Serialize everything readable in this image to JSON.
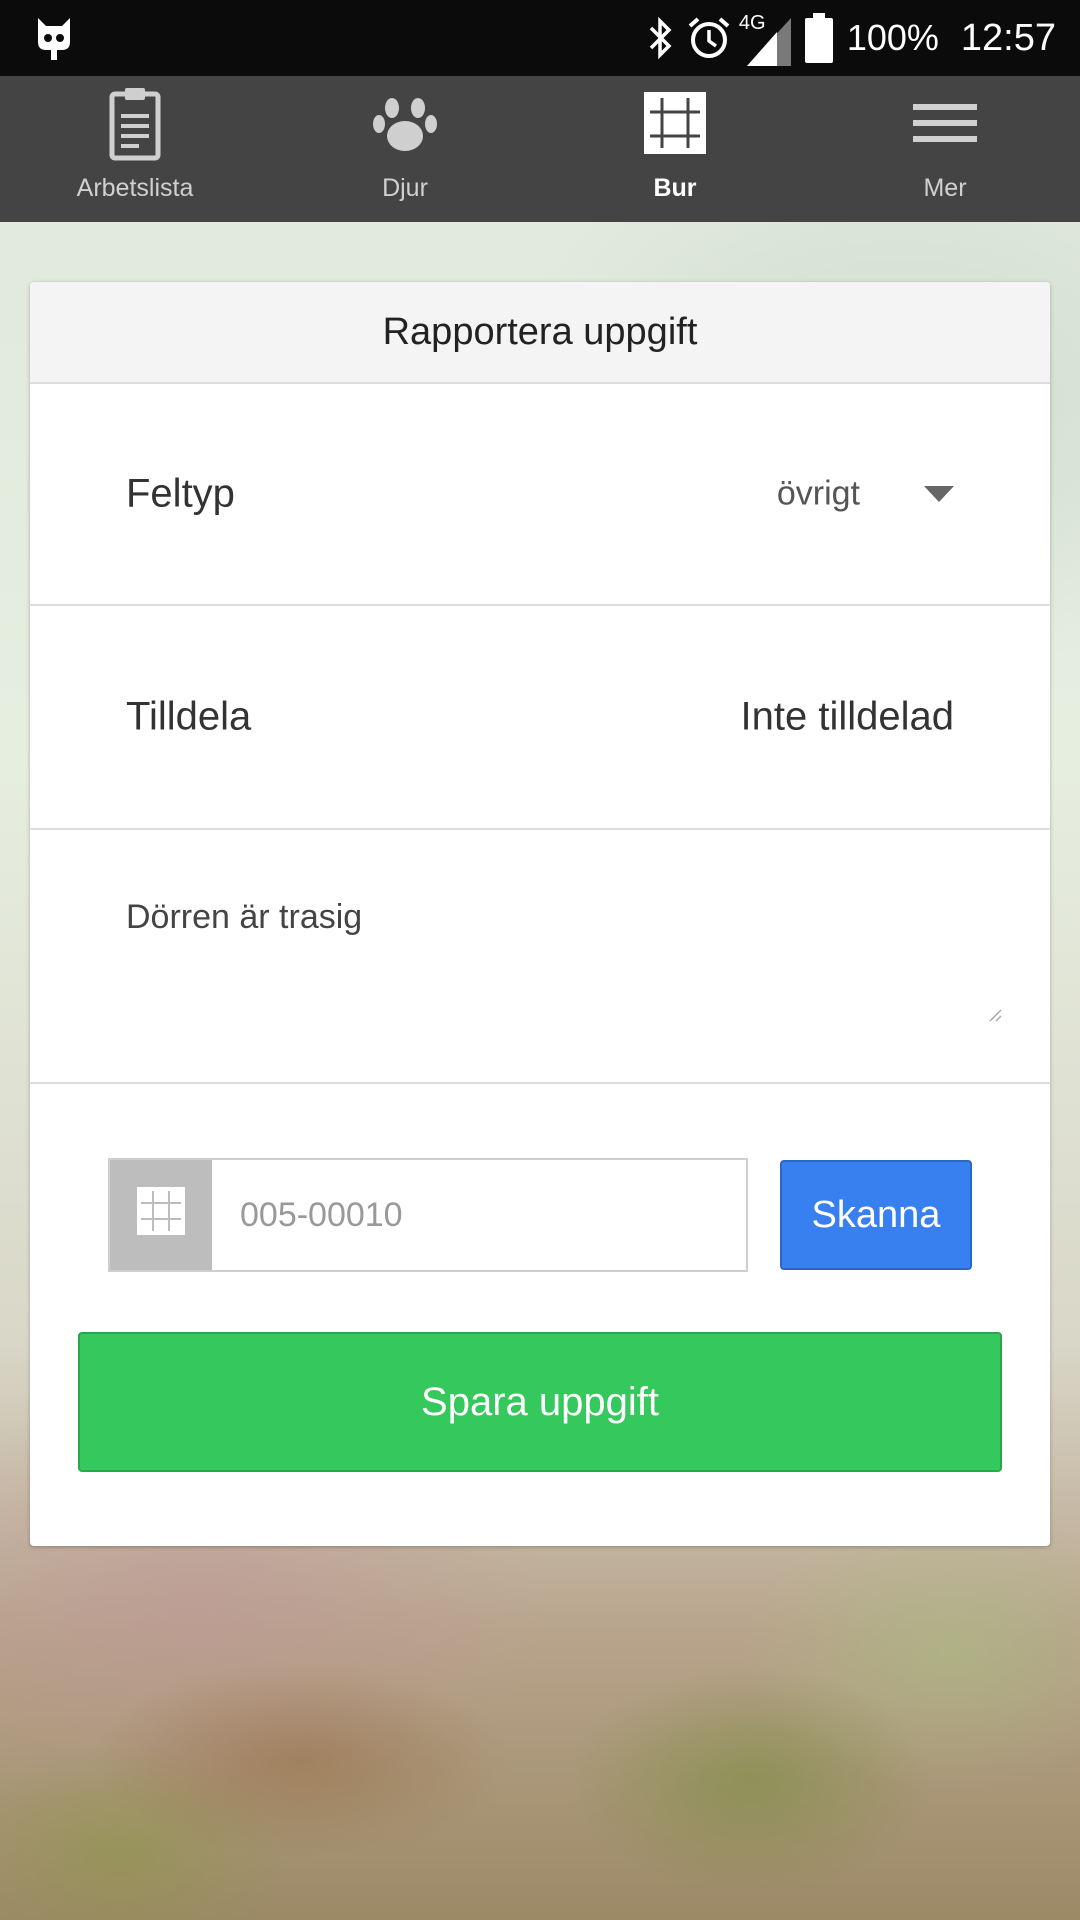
{
  "status_bar": {
    "battery": "100%",
    "time": "12:57",
    "network": "4G",
    "icons": [
      "cyanogen-icon",
      "bluetooth-icon",
      "alarm-icon",
      "signal-icon",
      "battery-icon"
    ]
  },
  "nav": {
    "items": [
      {
        "label": "Arbetslista",
        "icon": "clipboard-icon",
        "active": false
      },
      {
        "label": "Djur",
        "icon": "paw-icon",
        "active": false
      },
      {
        "label": "Bur",
        "icon": "grid-icon",
        "active": true
      },
      {
        "label": "Mer",
        "icon": "menu-icon",
        "active": false
      }
    ]
  },
  "form": {
    "title": "Rapportera uppgift",
    "feltyp": {
      "label": "Feltyp",
      "value": "övrigt"
    },
    "tilldela": {
      "label": "Tilldela",
      "value": "Inte tilldelad"
    },
    "description": "Dörren är trasig",
    "cage": {
      "placeholder": "005-00010"
    },
    "scan_label": "Skanna",
    "save_label": "Spara uppgift"
  },
  "colors": {
    "scan_button": "#3880f0",
    "save_button": "#35c85c",
    "navbar": "#444444"
  }
}
